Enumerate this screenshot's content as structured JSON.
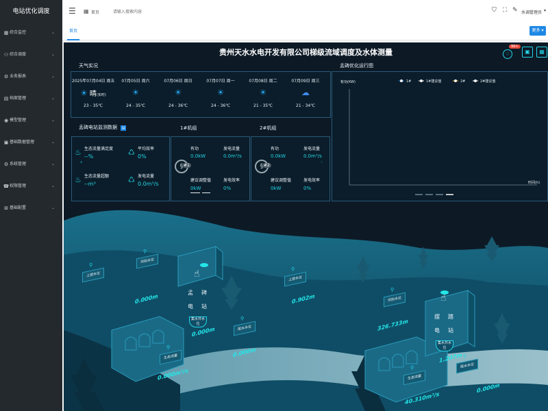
{
  "sidebar": {
    "title": "电站优化调度",
    "items": [
      {
        "icon": "grid-icon",
        "glyph": "▦",
        "label": "综合监控"
      },
      {
        "icon": "user-icon",
        "glyph": "⚇",
        "label": "综合调度"
      },
      {
        "icon": "settings-icon",
        "glyph": "⚙",
        "label": "业务报表"
      },
      {
        "icon": "folder-icon",
        "glyph": "▤",
        "label": "档案管理"
      },
      {
        "icon": "model-icon",
        "glyph": "◉",
        "label": "模型管理"
      },
      {
        "icon": "database-icon",
        "glyph": "▣",
        "label": "基础数据管理"
      },
      {
        "icon": "system-icon",
        "glyph": "⚙",
        "label": "系统管理"
      },
      {
        "icon": "phone-icon",
        "glyph": "☎",
        "label": "权限管理"
      },
      {
        "icon": "config-icon",
        "glyph": "⊞",
        "label": "基础配置"
      }
    ]
  },
  "topbar": {
    "breadcrumb": "首页",
    "search_placeholder": "请输入搜索内容",
    "user": "水调管理员"
  },
  "tabs": {
    "active": "首页",
    "more": "更多"
  },
  "dashboard": {
    "title": "贵州天水水电开发有限公司梯级流域调度及水体测量",
    "badge": "99+",
    "weather_title": "天气实况",
    "weather": [
      {
        "date": "2025年07月04日 周五",
        "icon": "sun-icon",
        "desc": "晴",
        "note": "(实时)",
        "temp": "23 - 35℃"
      },
      {
        "date": "07月05日 周六",
        "icon": "sun-icon",
        "desc": "",
        "note": "",
        "temp": "24 - 35℃"
      },
      {
        "date": "07月06日 周日",
        "icon": "sun-icon",
        "desc": "",
        "note": "",
        "temp": "24 - 36℃"
      },
      {
        "date": "07月07日 周一",
        "icon": "sun-icon",
        "desc": "",
        "note": "",
        "temp": "24 - 36℃"
      },
      {
        "date": "07月08日 周二",
        "icon": "sun-icon",
        "desc": "",
        "note": "",
        "temp": "21 - 35℃"
      },
      {
        "date": "07月09日 周三",
        "icon": "cloud-icon",
        "desc": "",
        "note": "",
        "temp": "21 - 34℃"
      }
    ],
    "monitor": {
      "title": "孟碑电站监测数据",
      "unit_1": "1#机组",
      "unit_2": "2#机组",
      "eco_sat_label": "生态流量满足度",
      "eco_sat_value": "--%",
      "avg_eff_label": "平均效率",
      "avg_eff_value": "0%",
      "eco_total_label": "生态流量超额",
      "eco_total_value": "--m³",
      "gen_flow_label": "发电流量",
      "gen_flow_value": "0.0m³/s",
      "units": [
        {
          "badge": "#1",
          "p_label": "有功",
          "p_value": "0.0kW",
          "q_label": "发电流量",
          "q_value": "0.0m³/s",
          "adj_label": "建议调整值",
          "adj_value": "0kW",
          "eff_label": "发电效率",
          "eff_value": "0%"
        },
        {
          "badge": "#2",
          "p_label": "有功",
          "p_value": "0.0kW",
          "q_label": "发电流量",
          "q_value": "0.0m³/s",
          "adj_label": "建议调整值",
          "adj_value": "0kW",
          "eff_label": "发电效率",
          "eff_value": "0%"
        }
      ]
    },
    "chart": {
      "title": "孟碑优化运行图",
      "ylabel": "有功(KW)",
      "xlabel": "时间(h)",
      "legend": [
        "1#",
        "1#建议值",
        "2#",
        "2#建议值"
      ]
    },
    "map": {
      "labels": [
        {
          "text": "上游水位",
          "value": ""
        },
        {
          "text": "坝前水位",
          "value": "0.000m"
        },
        {
          "text": "生态流量",
          "value": "0.000m³/s"
        },
        {
          "text": "尾水水位",
          "value": "0.000m"
        },
        {
          "text": "上游水位",
          "value": "0.902m"
        },
        {
          "text": "坝前水位",
          "value": "326.733m"
        },
        {
          "text": "生态流量",
          "value": "40.310m³/s"
        },
        {
          "text": "尾水水位",
          "value": "0.000m"
        }
      ],
      "station_1": {
        "chars": [
          "孟",
          "碑",
          "电",
          "站"
        ],
        "badge": "集水井水位",
        "value": "0.000m"
      },
      "station_2": {
        "chars": [
          "摆",
          "踏",
          "电",
          "站"
        ],
        "badge": "集水井水位",
        "value": "1.207m"
      }
    }
  },
  "chart_data": {
    "type": "line",
    "title": "孟碑优化运行图",
    "xlabel": "时间(h)",
    "ylabel": "有功(KW)",
    "series": [
      {
        "name": "1#",
        "values": []
      },
      {
        "name": "1#建议值",
        "values": []
      },
      {
        "name": "2#",
        "values": []
      },
      {
        "name": "2#建议值",
        "values": []
      }
    ],
    "legend": "top-center",
    "grid": false
  }
}
